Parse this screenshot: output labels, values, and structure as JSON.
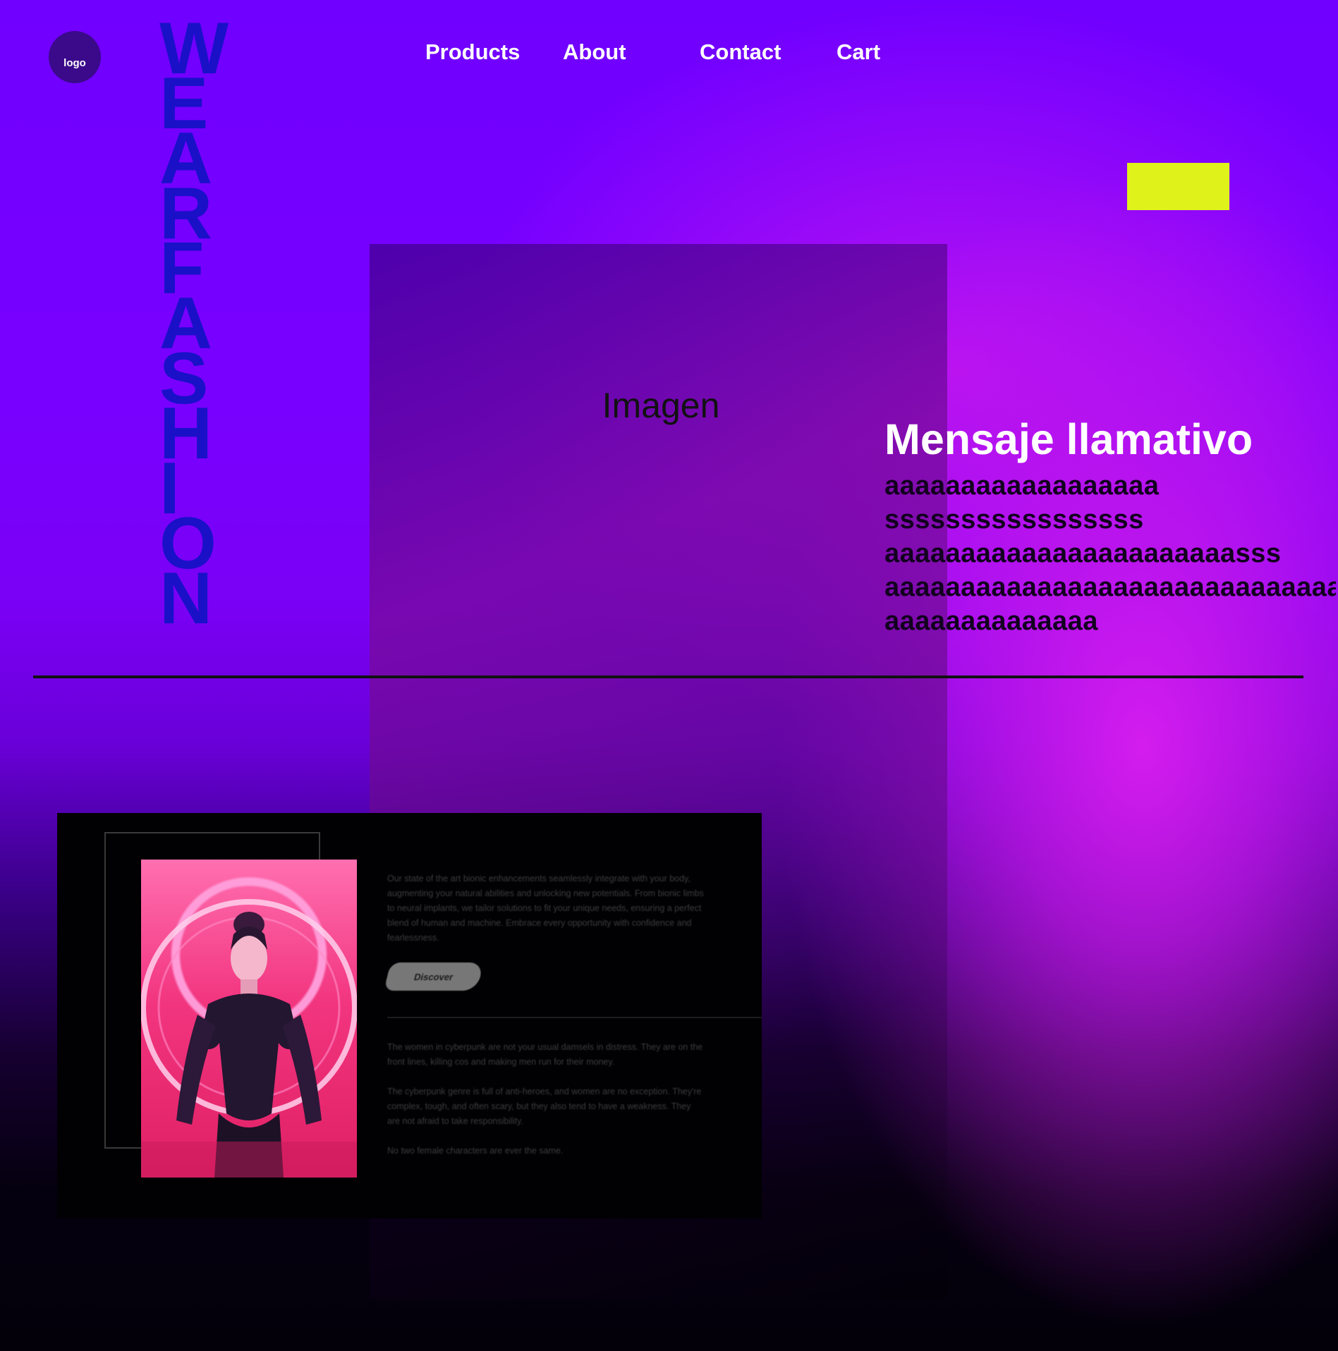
{
  "logo": {
    "label": "logo"
  },
  "brand": {
    "letters": [
      "W",
      "E",
      "A",
      "R",
      "F",
      "A",
      "S",
      "H",
      "I",
      "O",
      "N"
    ]
  },
  "nav": {
    "products": "Products",
    "about": "About",
    "contact": "Contact",
    "cart": "Cart"
  },
  "colors": {
    "cta": "#dff21a",
    "brand_text": "#1a10c8",
    "background_top": "#7000ff",
    "accent_magenta": "#da1ef0"
  },
  "image_placeholder": {
    "label": "Imagen"
  },
  "message": {
    "headline": "Mensaje llamativo",
    "lines": [
      "aaaaaaaaaaaaaaaaaa",
      "sssssssssssssssss",
      "aaaaaaaaaaaaaaaaaaaaaaasss",
      "aaaaaaaaaaaaaaaaaaaaaaaaaaaaaaaa",
      "aaaaaaaaaaaaaa"
    ]
  },
  "card": {
    "paragraph_1": "Our state of the art bionic enhancements seamlessly integrate with your body, augmenting your natural abilities and unlocking new potentials. From bionic limbs to neural implants, we tailor solutions to fit your unique needs, ensuring a perfect blend of human and machine. Embrace every opportunity with confidence and fearlessness.",
    "button": "Discover",
    "paragraph_2": "The women in cyberpunk are not your usual damsels in distress. They are on the front lines, killing cos and making men run for their money.",
    "paragraph_3": "The cyberpunk genre is full of anti-heroes, and women are no exception. They're complex, tough, and often scary, but they also tend to have a weakness. They are not afraid to take responsibility.",
    "paragraph_4": "No two female characters are ever the same."
  }
}
